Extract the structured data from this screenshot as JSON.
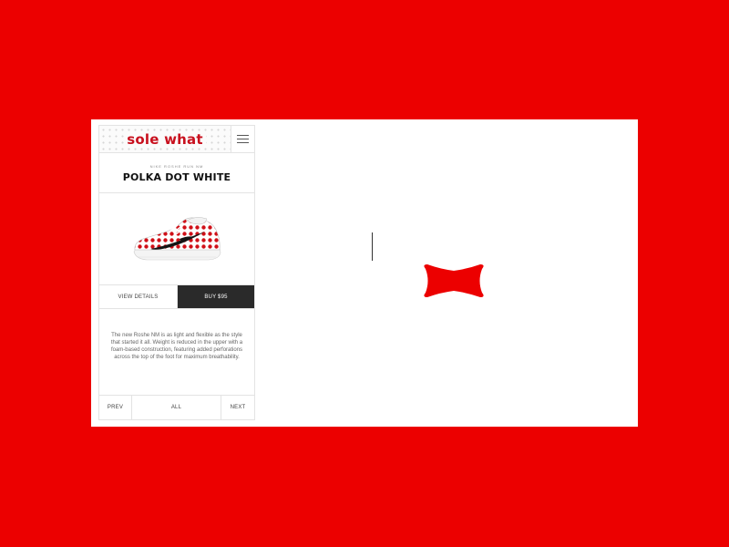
{
  "brand": {
    "logo_text": "sole what",
    "logo_color": "#c8101e"
  },
  "background_color": "#ec0000",
  "header": {
    "menu_icon": "hamburger-icon"
  },
  "product": {
    "model": "NIKE ROSHE RUN NM",
    "name": "POLKA DOT WHITE",
    "image_icon": "sneaker-image",
    "description": "The new Roshe NM is as light and flexible as the style that started it all. Weight is reduced in the upper with a foam-based construction, featuring added perforations across the top of the foot for maximum breathability."
  },
  "actions": {
    "details_label": "VIEW DETAILS",
    "buy_label": "BUY $95"
  },
  "pager": {
    "prev_label": "PREV",
    "all_label": "ALL",
    "next_label": "NEXT"
  },
  "decorations": {
    "bow_icon": "bow-tie-icon",
    "bow_color": "#ec0000"
  }
}
